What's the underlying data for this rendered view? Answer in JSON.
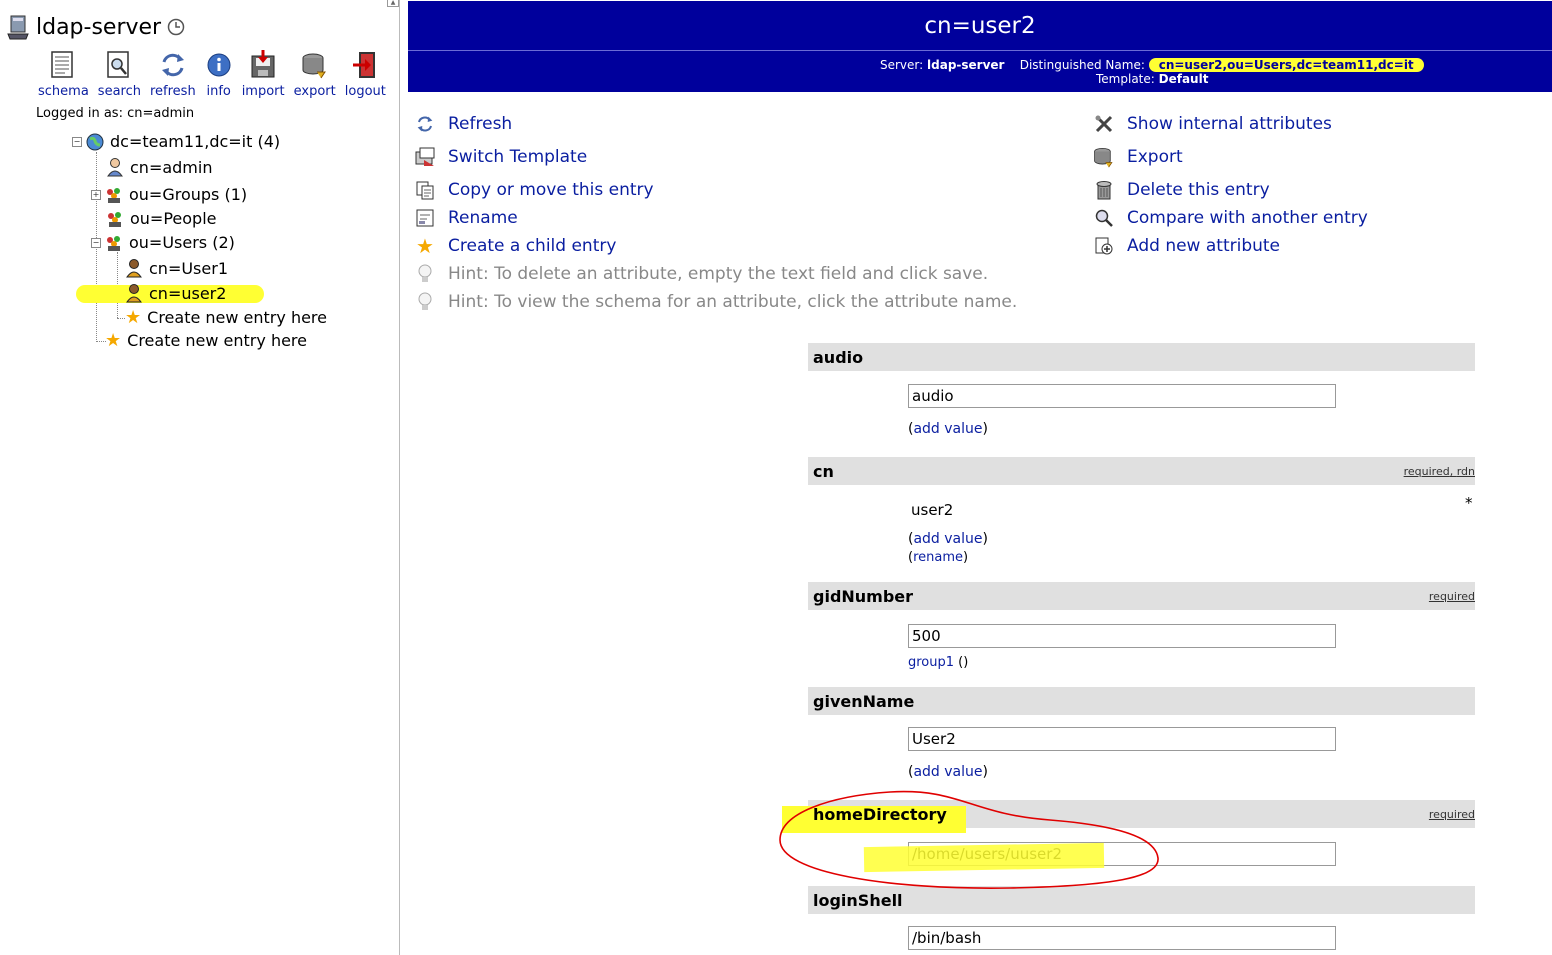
{
  "left": {
    "server_name": "ldap-server",
    "toolbar": [
      {
        "label": "schema",
        "icon": "schema-icon"
      },
      {
        "label": "search",
        "icon": "search-icon"
      },
      {
        "label": "refresh",
        "icon": "refresh-icon"
      },
      {
        "label": "info",
        "icon": "info-icon"
      },
      {
        "label": "import",
        "icon": "import-icon"
      },
      {
        "label": "export",
        "icon": "export-icon"
      },
      {
        "label": "logout",
        "icon": "logout-icon"
      }
    ],
    "logged_in": "Logged in as: cn=admin",
    "tree": {
      "root": "dc=team11,dc=it (4)",
      "admin": "cn=admin",
      "groups": "ou=Groups (1)",
      "people": "ou=People",
      "users": "ou=Users (2)",
      "user1": "cn=User1",
      "user2": "cn=user2",
      "create_inner": "Create new entry here",
      "create_outer": "Create new entry here"
    }
  },
  "header": {
    "title": "cn=user2",
    "server_label": "Server:",
    "server_value": "ldap-server",
    "dn_label": "Distinguished Name:",
    "dn_value": "cn=user2,ou=Users,dc=team11,dc=it",
    "template_label": "Template:",
    "template_value": "Default"
  },
  "actions_left": [
    {
      "label": "Refresh",
      "icon": "refresh-icon"
    },
    {
      "label": "Switch Template",
      "icon": "switch-template-icon"
    },
    {
      "label": "Copy or move this entry",
      "icon": "copy-icon"
    },
    {
      "label": "Rename",
      "icon": "rename-icon"
    },
    {
      "label": "Create a child entry",
      "icon": "star-icon"
    }
  ],
  "hints": [
    "Hint: To delete an attribute, empty the text field and click save.",
    "Hint: To view the schema for an attribute, click the attribute name."
  ],
  "actions_right": [
    {
      "label": "Show internal attributes",
      "icon": "tools-icon"
    },
    {
      "label": "Export",
      "icon": "export-icon"
    },
    {
      "label": "Delete this entry",
      "icon": "trash-icon"
    },
    {
      "label": "Compare with another entry",
      "icon": "compare-icon"
    },
    {
      "label": "Add new attribute",
      "icon": "add-attribute-icon"
    }
  ],
  "attributes": {
    "audio": {
      "name": "audio",
      "value": "audio",
      "add": "add value"
    },
    "cn": {
      "name": "cn",
      "badge_required": "required",
      "badge_rdn": "rdn",
      "value": "user2",
      "add": "add value",
      "rename": "rename",
      "star": "*"
    },
    "gidNumber": {
      "name": "gidNumber",
      "badge": "required",
      "value": "500",
      "group_link": "group1",
      "group_suffix": " ()"
    },
    "givenName": {
      "name": "givenName",
      "value": "User2",
      "add": "add value"
    },
    "homeDirectory": {
      "name": "homeDirectory",
      "badge": "required",
      "value": "/home/users/uuser2"
    },
    "loginShell": {
      "name": "loginShell",
      "value": "/bin/bash"
    }
  },
  "colors": {
    "header_bg": "#00009c",
    "link": "#0a1ea0",
    "highlight": "#ffff33",
    "annotation": "#e00000"
  }
}
